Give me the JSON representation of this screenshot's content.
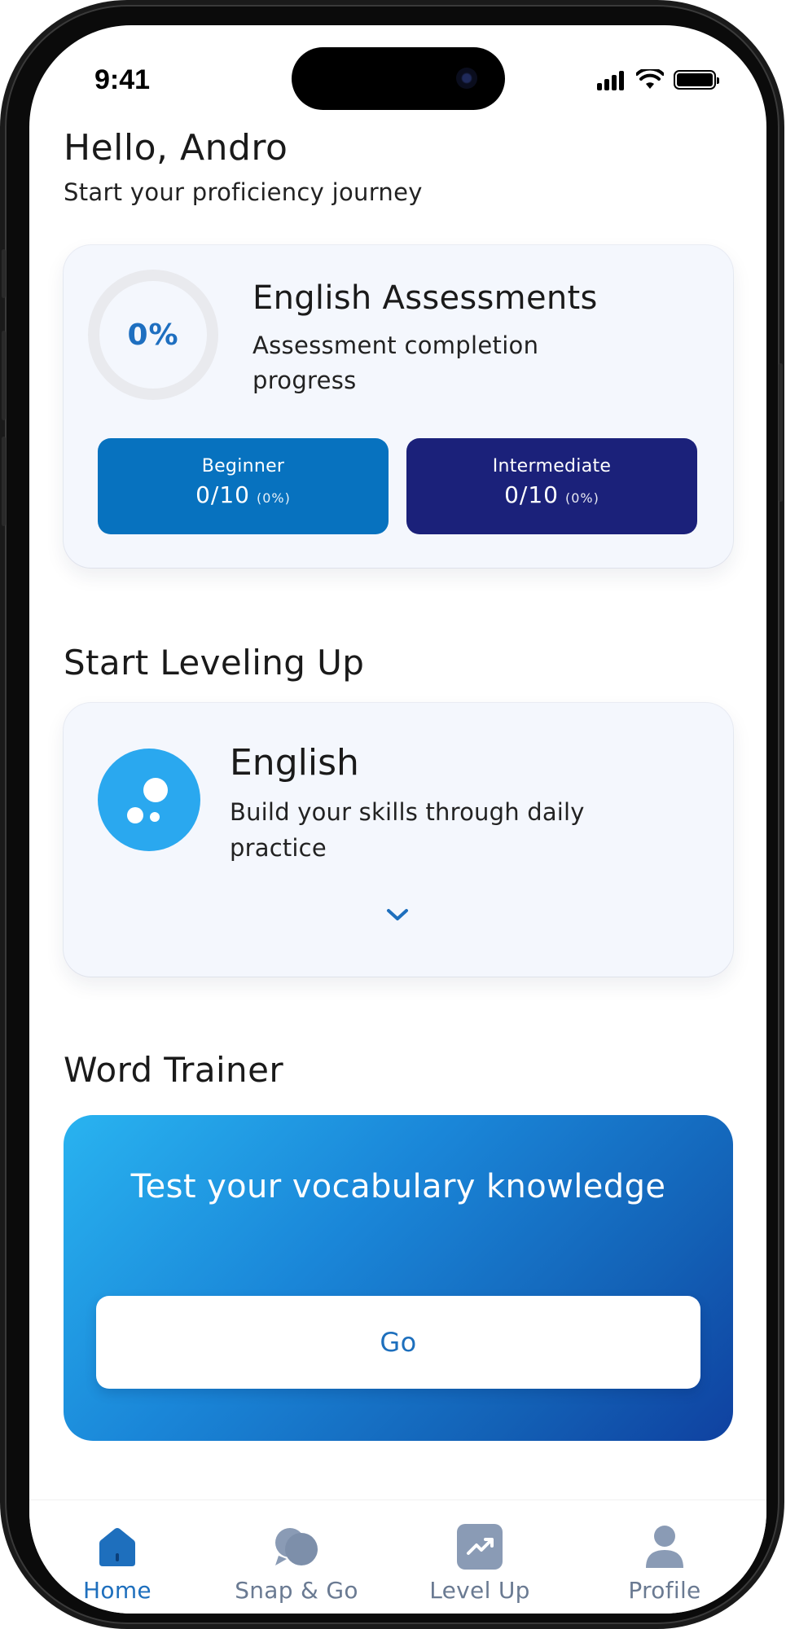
{
  "status_bar": {
    "time": "9:41"
  },
  "header": {
    "greeting": "Hello, Andro",
    "subtitle": "Start your proficiency journey"
  },
  "assessment": {
    "progress_label": "0%",
    "progress_fraction": 0,
    "title": "English Assessments",
    "description": "Assessment completion progress",
    "levels": [
      {
        "label": "Beginner",
        "value": "0/10",
        "percent": "(0%)",
        "color": "#0772bf"
      },
      {
        "label": "Intermediate",
        "value": "0/10",
        "percent": "(0%)",
        "color": "#1b217a"
      }
    ]
  },
  "leveling": {
    "section_title": "Start Leveling Up",
    "course_title": "English",
    "course_description": "Build your skills through daily practice",
    "icon": "bubbles-icon",
    "expand_icon": "chevron-down-icon"
  },
  "word_trainer": {
    "section_title": "Word Trainer",
    "prompt": "Test your vocabulary knowledge",
    "button_label": "Go"
  },
  "tabbar": {
    "items": [
      {
        "label": "Home",
        "icon": "home-icon",
        "active": true
      },
      {
        "label": "Snap & Go",
        "icon": "chat-bubbles-icon",
        "active": false
      },
      {
        "label": "Level Up",
        "icon": "trend-up-icon",
        "active": false
      },
      {
        "label": "Profile",
        "icon": "person-icon",
        "active": false
      }
    ]
  },
  "colors": {
    "accent": "#1e6fbd",
    "beginner": "#0772bf",
    "intermediate": "#1b217a",
    "english_icon_bg": "#2aa8ef",
    "card_bg": "#f4f7fd"
  }
}
